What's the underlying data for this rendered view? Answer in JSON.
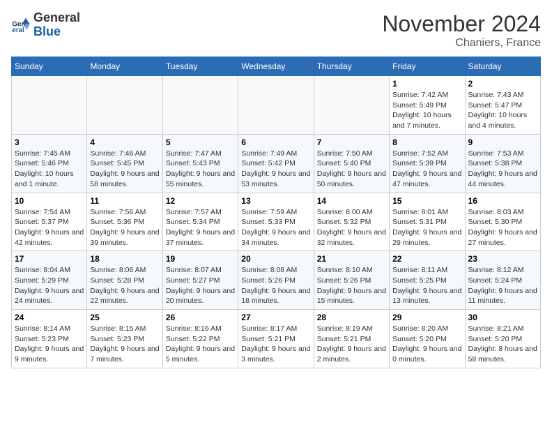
{
  "logo": {
    "text_general": "General",
    "text_blue": "Blue"
  },
  "header": {
    "month": "November 2024",
    "location": "Chaniers, France"
  },
  "days_of_week": [
    "Sunday",
    "Monday",
    "Tuesday",
    "Wednesday",
    "Thursday",
    "Friday",
    "Saturday"
  ],
  "weeks": [
    [
      {
        "day": "",
        "info": ""
      },
      {
        "day": "",
        "info": ""
      },
      {
        "day": "",
        "info": ""
      },
      {
        "day": "",
        "info": ""
      },
      {
        "day": "",
        "info": ""
      },
      {
        "day": "1",
        "info": "Sunrise: 7:42 AM\nSunset: 5:49 PM\nDaylight: 10 hours and 7 minutes."
      },
      {
        "day": "2",
        "info": "Sunrise: 7:43 AM\nSunset: 5:47 PM\nDaylight: 10 hours and 4 minutes."
      }
    ],
    [
      {
        "day": "3",
        "info": "Sunrise: 7:45 AM\nSunset: 5:46 PM\nDaylight: 10 hours and 1 minute."
      },
      {
        "day": "4",
        "info": "Sunrise: 7:46 AM\nSunset: 5:45 PM\nDaylight: 9 hours and 58 minutes."
      },
      {
        "day": "5",
        "info": "Sunrise: 7:47 AM\nSunset: 5:43 PM\nDaylight: 9 hours and 55 minutes."
      },
      {
        "day": "6",
        "info": "Sunrise: 7:49 AM\nSunset: 5:42 PM\nDaylight: 9 hours and 53 minutes."
      },
      {
        "day": "7",
        "info": "Sunrise: 7:50 AM\nSunset: 5:40 PM\nDaylight: 9 hours and 50 minutes."
      },
      {
        "day": "8",
        "info": "Sunrise: 7:52 AM\nSunset: 5:39 PM\nDaylight: 9 hours and 47 minutes."
      },
      {
        "day": "9",
        "info": "Sunrise: 7:53 AM\nSunset: 5:38 PM\nDaylight: 9 hours and 44 minutes."
      }
    ],
    [
      {
        "day": "10",
        "info": "Sunrise: 7:54 AM\nSunset: 5:37 PM\nDaylight: 9 hours and 42 minutes."
      },
      {
        "day": "11",
        "info": "Sunrise: 7:56 AM\nSunset: 5:36 PM\nDaylight: 9 hours and 39 minutes."
      },
      {
        "day": "12",
        "info": "Sunrise: 7:57 AM\nSunset: 5:34 PM\nDaylight: 9 hours and 37 minutes."
      },
      {
        "day": "13",
        "info": "Sunrise: 7:59 AM\nSunset: 5:33 PM\nDaylight: 9 hours and 34 minutes."
      },
      {
        "day": "14",
        "info": "Sunrise: 8:00 AM\nSunset: 5:32 PM\nDaylight: 9 hours and 32 minutes."
      },
      {
        "day": "15",
        "info": "Sunrise: 8:01 AM\nSunset: 5:31 PM\nDaylight: 9 hours and 29 minutes."
      },
      {
        "day": "16",
        "info": "Sunrise: 8:03 AM\nSunset: 5:30 PM\nDaylight: 9 hours and 27 minutes."
      }
    ],
    [
      {
        "day": "17",
        "info": "Sunrise: 8:04 AM\nSunset: 5:29 PM\nDaylight: 9 hours and 24 minutes."
      },
      {
        "day": "18",
        "info": "Sunrise: 8:06 AM\nSunset: 5:28 PM\nDaylight: 9 hours and 22 minutes."
      },
      {
        "day": "19",
        "info": "Sunrise: 8:07 AM\nSunset: 5:27 PM\nDaylight: 9 hours and 20 minutes."
      },
      {
        "day": "20",
        "info": "Sunrise: 8:08 AM\nSunset: 5:26 PM\nDaylight: 9 hours and 18 minutes."
      },
      {
        "day": "21",
        "info": "Sunrise: 8:10 AM\nSunset: 5:26 PM\nDaylight: 9 hours and 15 minutes."
      },
      {
        "day": "22",
        "info": "Sunrise: 8:11 AM\nSunset: 5:25 PM\nDaylight: 9 hours and 13 minutes."
      },
      {
        "day": "23",
        "info": "Sunrise: 8:12 AM\nSunset: 5:24 PM\nDaylight: 9 hours and 11 minutes."
      }
    ],
    [
      {
        "day": "24",
        "info": "Sunrise: 8:14 AM\nSunset: 5:23 PM\nDaylight: 9 hours and 9 minutes."
      },
      {
        "day": "25",
        "info": "Sunrise: 8:15 AM\nSunset: 5:23 PM\nDaylight: 9 hours and 7 minutes."
      },
      {
        "day": "26",
        "info": "Sunrise: 8:16 AM\nSunset: 5:22 PM\nDaylight: 9 hours and 5 minutes."
      },
      {
        "day": "27",
        "info": "Sunrise: 8:17 AM\nSunset: 5:21 PM\nDaylight: 9 hours and 3 minutes."
      },
      {
        "day": "28",
        "info": "Sunrise: 8:19 AM\nSunset: 5:21 PM\nDaylight: 9 hours and 2 minutes."
      },
      {
        "day": "29",
        "info": "Sunrise: 8:20 AM\nSunset: 5:20 PM\nDaylight: 9 hours and 0 minutes."
      },
      {
        "day": "30",
        "info": "Sunrise: 8:21 AM\nSunset: 5:20 PM\nDaylight: 8 hours and 58 minutes."
      }
    ]
  ]
}
